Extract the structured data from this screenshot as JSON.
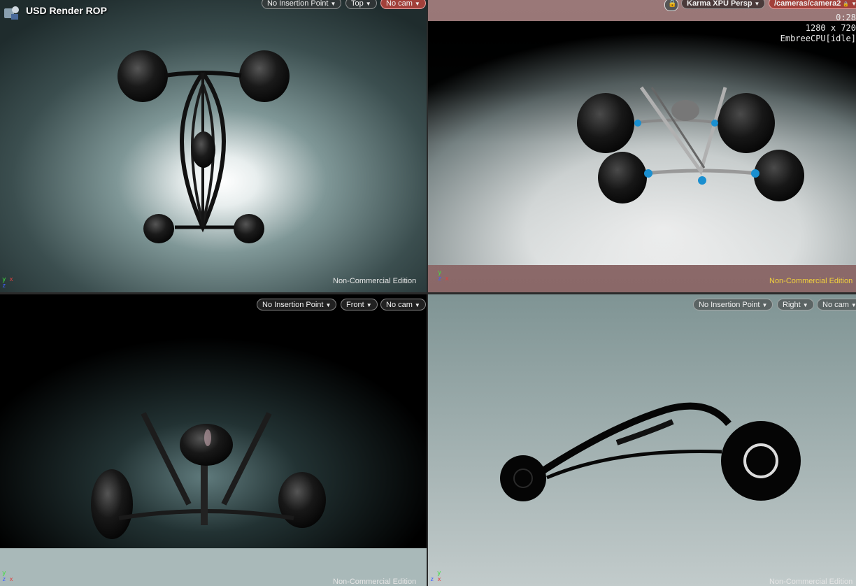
{
  "top_left": {
    "title": "USD Render ROP",
    "menus": [
      {
        "label": "No Insertion Point"
      },
      {
        "label": "Top"
      },
      {
        "label": "No cam"
      }
    ],
    "watermark": "Non-Commercial Edition",
    "axes": {
      "a": "y",
      "b": "x",
      "c": "z"
    }
  },
  "top_right": {
    "renderer_menu": "Karma XPU  Persp",
    "camera_menu": "/cameras/camera2",
    "hud": {
      "time": "0:28",
      "resolution": "1280 x 720",
      "status": "EmbreeCPU[idle]"
    },
    "watermark": "Non-Commercial Edition",
    "axes": {
      "a": "y",
      "b": "x",
      "c": "z"
    }
  },
  "bottom_left": {
    "menus": [
      {
        "label": "No Insertion Point"
      },
      {
        "label": "Front"
      },
      {
        "label": "No cam"
      }
    ],
    "watermark": "Non-Commercial Edition",
    "axes": {
      "a": "y",
      "b": "x",
      "c": "z"
    }
  },
  "bottom_right": {
    "menus": [
      {
        "label": "No Insertion Point"
      },
      {
        "label": "Right"
      },
      {
        "label": "No cam"
      }
    ],
    "watermark": "Non-Commercial Edition",
    "axes": {
      "a": "y",
      "b": "x",
      "c": "z"
    }
  },
  "colors": {
    "accent_red": "#a2403a",
    "watermark_yellow": "#f2d23c",
    "axis_x": "#e04040",
    "axis_y": "#40e040",
    "axis_z": "#4060ff"
  }
}
